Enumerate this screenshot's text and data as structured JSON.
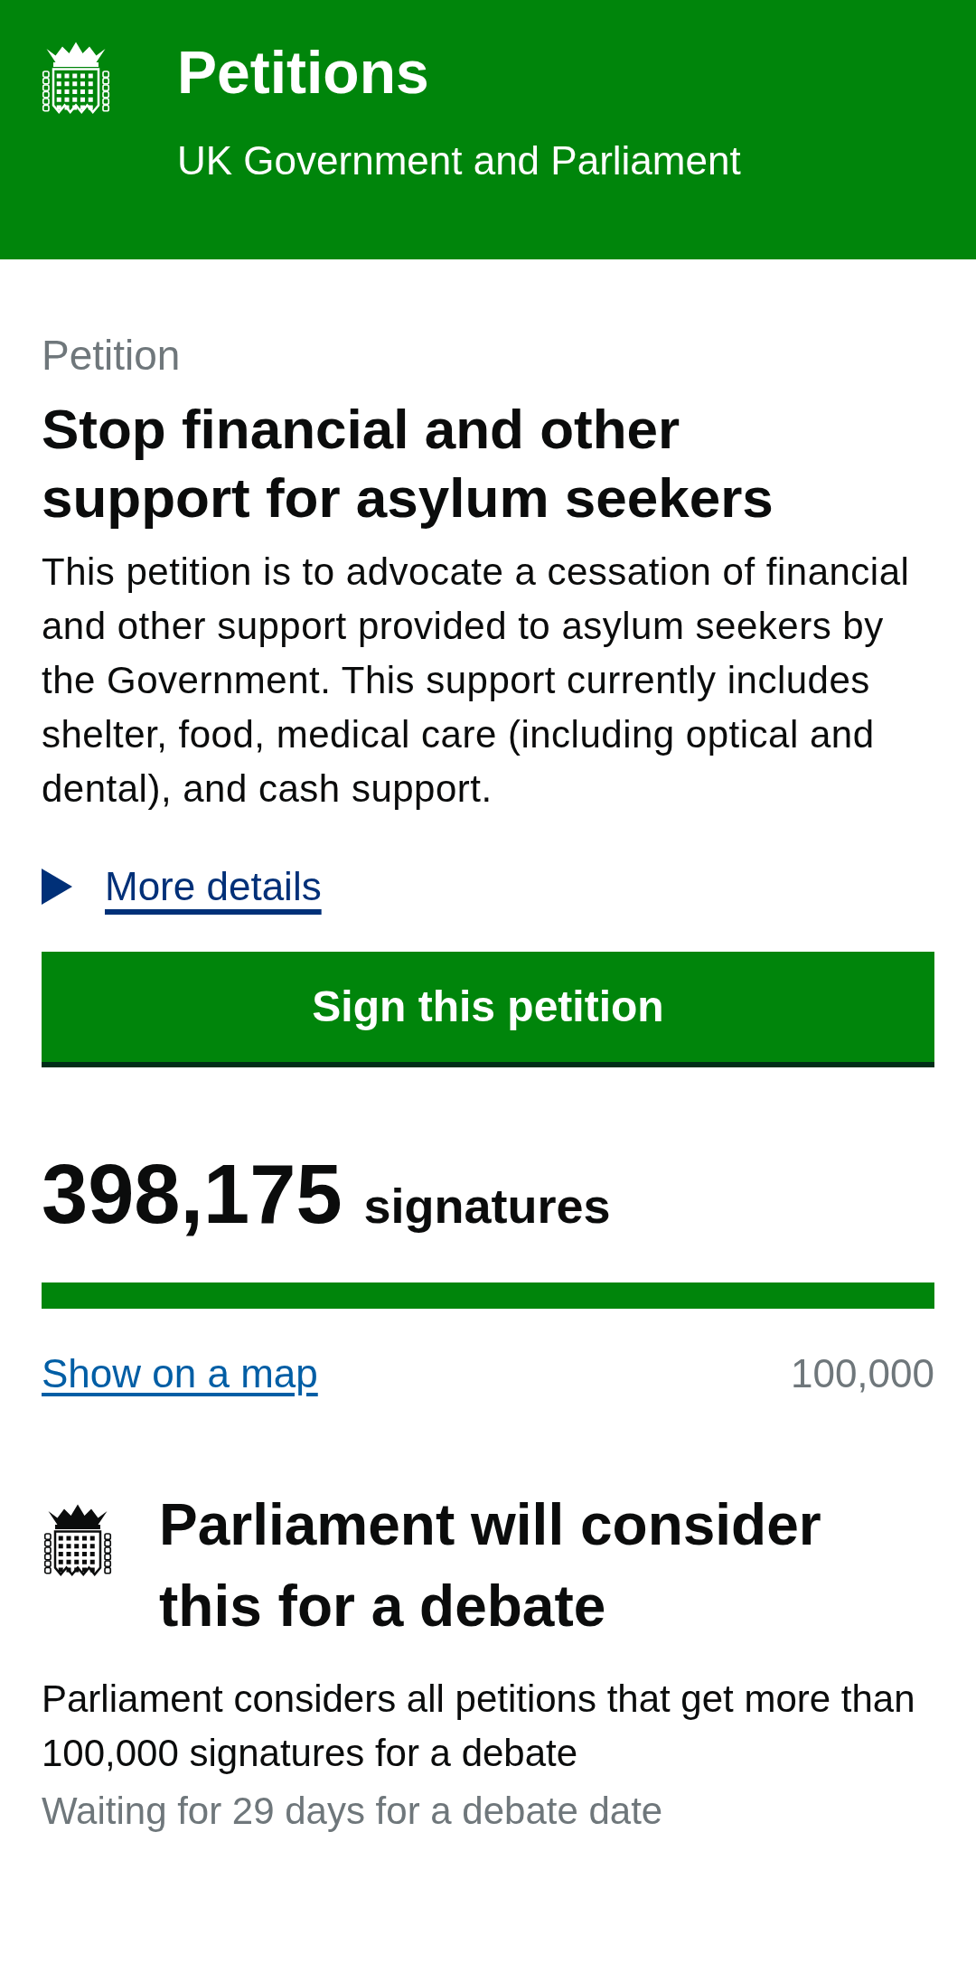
{
  "header": {
    "title": "Petitions",
    "subtitle": "UK Government and Parliament"
  },
  "petition": {
    "label": "Petition",
    "title": "Stop financial and other support for asylum seekers",
    "description": "This petition is to advocate a cessation of financial and other support provided to asylum seekers by the Government. This support currently includes shelter, food, medical care (including optical and dental), and cash support.",
    "details": {
      "label": "More details",
      "expanded": false
    },
    "sign_button": "Sign this petition"
  },
  "signatures": {
    "count": "398,175",
    "unit": "signatures",
    "level": 1,
    "map_link": "Show on a map",
    "threshold": "100,000"
  },
  "debate": {
    "title": "Parliament will consider this for a debate",
    "text": "Parliament considers all petitions that get more than 100,000 signatures for a debate",
    "status": "Waiting for 29 days for a debate date"
  }
}
